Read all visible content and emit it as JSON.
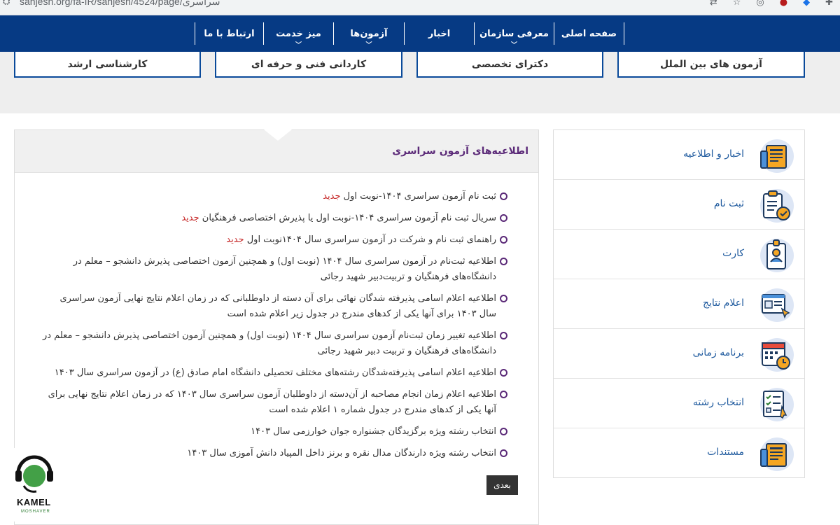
{
  "browser": {
    "url": "sanjesh.org/fa-IR/sanjesh/4524/page/سراسری",
    "site_icon": "⛭",
    "icons": [
      "translate-icon",
      "star-icon",
      "extension-icon",
      "extension-red-icon",
      "extension-blue-icon",
      "puzzle-icon"
    ]
  },
  "nav": {
    "items": [
      {
        "label": "صفحه اصلی",
        "dropdown": false
      },
      {
        "label": "معرفی سازمان",
        "dropdown": true
      },
      {
        "label": "اخبار",
        "dropdown": false
      },
      {
        "label": "آزمون‌ها",
        "dropdown": true
      },
      {
        "label": "میز خدمت",
        "dropdown": true
      },
      {
        "label": "ارتباط با ما",
        "dropdown": false
      }
    ]
  },
  "hero": {
    "boxes": [
      "آزمون های بین الملل",
      "دکترای تخصصی",
      "کاردانی فنی و حرفه ای",
      "کارشناسی ارشد"
    ]
  },
  "main": {
    "title": "اطلاعیه‌های آزمون سراسری",
    "new_label": "جدید",
    "announcements": [
      {
        "text": "ثبت نام آزمون سراسری ۱۴۰۴-نوبت اول",
        "is_new": true
      },
      {
        "text": "سریال ثبت نام آزمون سراسری ۱۴۰۴-نوبت اول یا پذیرش اختصاصی فرهنگیان",
        "is_new": true
      },
      {
        "text": "راهنمای ثبت نام و شرکت در آزمون سراسری سال ۱۴۰۴نوبت اول",
        "is_new": true
      },
      {
        "text": "اطلاعیه ثبت‌نام در آزمون سراسری  سال ۱۴۰۴ (نوبت اول) و همچنین آزمون اختصاصی پذیرش دانشجو – معلم در دانشگاه‌های فرهنگیان و تربیت‌دبیر شهید رجائی",
        "is_new": false
      },
      {
        "text": "اطلاعیه اعلام اسامی پذیرفته شدگان نهائی برای آن دسته از داوطلبانی که در زمان اعلام نتایج نهایی آزمون سراسری سال ۱۴۰۳ برای آنها یکی از کدهای مندرج در جدول زیر اعلام شده است",
        "is_new": false
      },
      {
        "text": "اطلاعیه تغییر زمان ثبت‌نام آزمون سراسری  سال ۱۴۰۴ (نوبت اول) و همچنین آزمون اختصاصی پذیرش دانشجو – معلم در دانشگاه‌های فرهنگیان و تربیت دبیر شهید رجائی",
        "is_new": false
      },
      {
        "text": "اطلاعیه اعلام اسامی پذیرفته‌شدگان رشته‌های مختلف تحصیلی دانشگاه امام صادق (ع) در آزمون سراسری سال ۱۴۰۳",
        "is_new": false
      },
      {
        "text": "اطلاعیه اعلام زمان انجام مصاحبه از آن‌دسته از داوطلبان آزمون سراسری سال ۱۴۰۳ که در زمان اعلام نتایج نهایی برای آنها یکی از کدهای مندرج در جدول شماره ۱ اعلام شده است",
        "is_new": false
      },
      {
        "text": "انتخاب رشته ویژه برگزیدگان جشنواره جوان خوارزمی سال ۱۴۰۳",
        "is_new": false
      },
      {
        "text": "انتخاب رشته ویژه دارندگان مدال نقره و برنز داخل المپیاد دانش آموزی سال ۱۴۰۳",
        "is_new": false
      }
    ],
    "next_label": "بعدی"
  },
  "sidebar": {
    "items": [
      {
        "label": "اخبار و اطلاعیه",
        "icon": "newspaper-icon"
      },
      {
        "label": "ثبت نام",
        "icon": "clipboard-check-icon"
      },
      {
        "label": "کارت",
        "icon": "id-card-icon"
      },
      {
        "label": "اعلام نتایج",
        "icon": "results-board-icon"
      },
      {
        "label": "برنامه زمانی",
        "icon": "calendar-clock-icon"
      },
      {
        "label": "انتخاب رشته",
        "icon": "checklist-icon"
      },
      {
        "label": "مستندات",
        "icon": "documents-icon"
      }
    ]
  },
  "logo": {
    "name": "KAMEL",
    "subtitle": "MOSHAVER"
  },
  "colors": {
    "nav_bg": "#063a84",
    "accent_purple": "#5b2a78",
    "new_red": "#c62828",
    "link_blue": "#1f5a9e",
    "icon_bg": "#dde6f5",
    "icon_orange": "#f5a623"
  }
}
